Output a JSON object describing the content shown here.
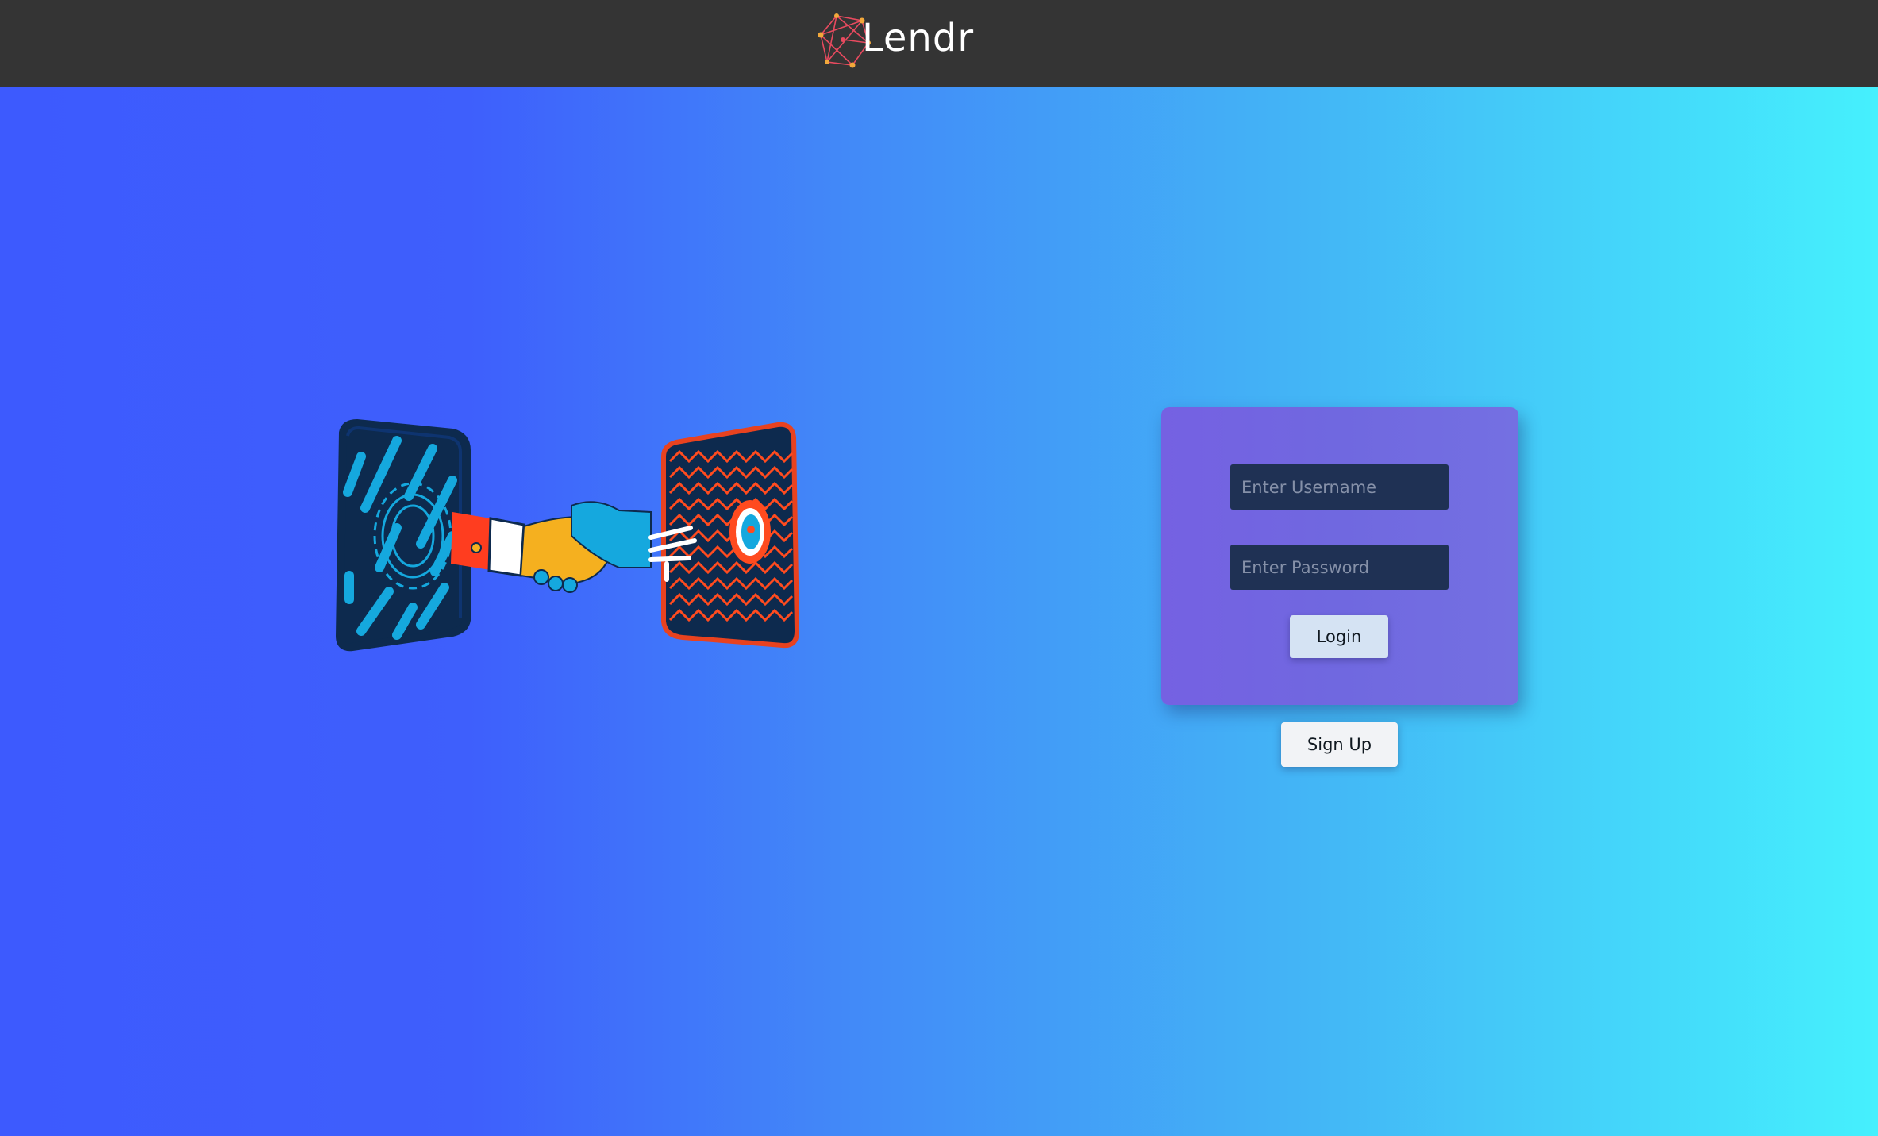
{
  "header": {
    "brand_name": "Lendr",
    "logo_icon": "network-polygon-logo",
    "background": "#343434"
  },
  "hero": {
    "illustration": "handshake-through-portals",
    "gradient_start": "#3d5afe",
    "gradient_end": "#45f0fd"
  },
  "login": {
    "username_placeholder": "Enter Username",
    "username_value": "",
    "password_placeholder": "Enter Password",
    "password_value": "",
    "login_label": "Login",
    "card_color": "#7366e1"
  },
  "signup": {
    "label": "Sign Up"
  }
}
